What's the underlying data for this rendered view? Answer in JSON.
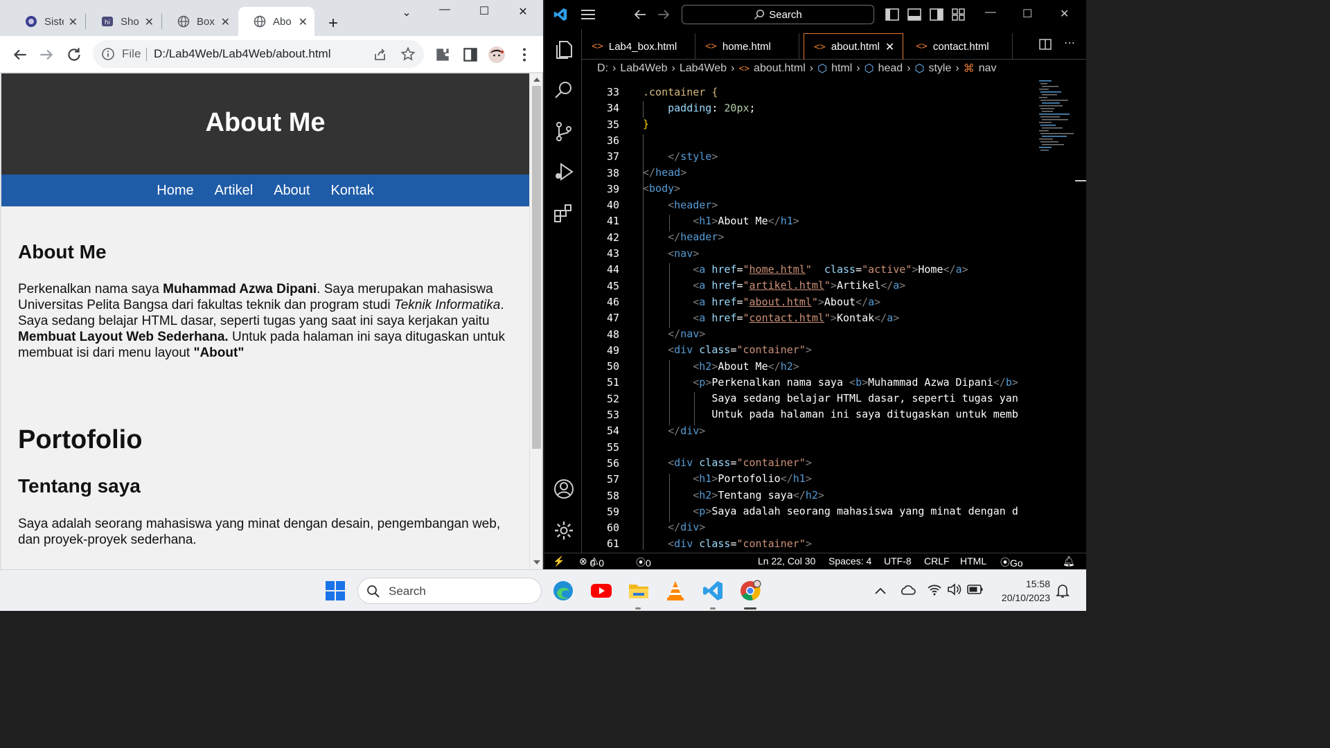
{
  "chrome": {
    "tabs": [
      {
        "title": "Siste",
        "active": false
      },
      {
        "title": "Sho",
        "active": false
      },
      {
        "title": "Box",
        "active": false
      },
      {
        "title": "Abo",
        "active": true
      }
    ],
    "omnibox": {
      "scheme_label": "File",
      "url": "D:/Lab4Web/Lab4Web/about.html"
    }
  },
  "webpage": {
    "header_title": "About Me",
    "nav": [
      "Home",
      "Artikel",
      "About",
      "Kontak"
    ],
    "about_heading": "About Me",
    "about_p": {
      "t1": "Perkenalkan nama saya ",
      "b1": "Muhammad Azwa Dipani",
      "t2": ". Saya merupakan mahasiswa Universitas Pelita Bangsa dari fakultas teknik dan program studi ",
      "i1": "Teknik Informatika",
      "t3": ". Saya sedang belajar HTML dasar, seperti tugas yang saat ini saya kerjakan yaitu ",
      "b2": "Membuat Layout Web Sederhana.",
      "t4": " Untuk pada halaman ini saya ditugaskan untuk membuat isi dari menu layout ",
      "b3": "\"About\""
    },
    "portfolio_heading": "Portofolio",
    "tentang_heading": "Tentang saya",
    "tentang_p": "Saya adalah seorang mahasiswa yang minat dengan desain, pengembangan web, dan proyek-proyek sederhana."
  },
  "vscode": {
    "search_label": "Search",
    "tabs": [
      {
        "label": "Lab4_box.html",
        "active": false
      },
      {
        "label": "home.html",
        "active": false
      },
      {
        "label": "about.html",
        "active": true
      },
      {
        "label": "contact.html",
        "active": false
      }
    ],
    "breadcrumbs": [
      "D:",
      "Lab4Web",
      "Lab4Web",
      "about.html",
      "html",
      "head",
      "style",
      "nav"
    ],
    "line_numbers": [
      "33",
      "34",
      "35",
      "36",
      "37",
      "38",
      "39",
      "40",
      "41",
      "42",
      "43",
      "44",
      "45",
      "46",
      "47",
      "48",
      "49",
      "50",
      "51",
      "52",
      "53",
      "54",
      "55",
      "56",
      "57",
      "58",
      "59",
      "60",
      "61"
    ],
    "status": {
      "errors": "0",
      "warnings": "0",
      "ports": "0",
      "position": "Ln 22, Col 30",
      "spaces": "Spaces: 4",
      "encoding": "UTF-8",
      "eol": "CRLF",
      "language": "HTML",
      "live": "Go Live"
    }
  },
  "code": {
    "l33": ".container {",
    "l34_prop": "padding",
    "l34_val": "20px",
    "l35": "}",
    "l37": "style",
    "l38": "head",
    "l39": "body",
    "l40": "header",
    "l41_tag": "h1",
    "l41_text": "About Me",
    "l42": "header",
    "l43": "nav",
    "links": [
      {
        "href": "home.html",
        "extra": true,
        "class_val": "active",
        "text": "Home"
      },
      {
        "href": "artikel.html",
        "extra": false,
        "text": "Artikel"
      },
      {
        "href": "about.html",
        "extra": false,
        "text": "About"
      },
      {
        "href": "contact.html",
        "extra": false,
        "text": "Kontak"
      }
    ],
    "l48": "nav",
    "container_class": "container",
    "l50_text": "About Me",
    "l51_text": "Perkenalkan nama saya ",
    "l51_bold": "Muhammad Azwa Dipani",
    "l52_text": "Saya sedang belajar HTML dasar, seperti tugas yan",
    "l53_text": "Untuk pada halaman ini saya ditugaskan untuk memb",
    "l57_text": "Portofolio",
    "l58_text": "Tentang saya",
    "l59_text": "Saya adalah seorang mahasiswa yang minat dengan d"
  },
  "taskbar": {
    "search_label": "Search",
    "time": "15:58",
    "date": "20/10/2023"
  },
  "colors": {
    "page_header_bg": "#333333",
    "page_nav_bg": "#1f5ca8",
    "vscode_accent": "#e37933"
  }
}
